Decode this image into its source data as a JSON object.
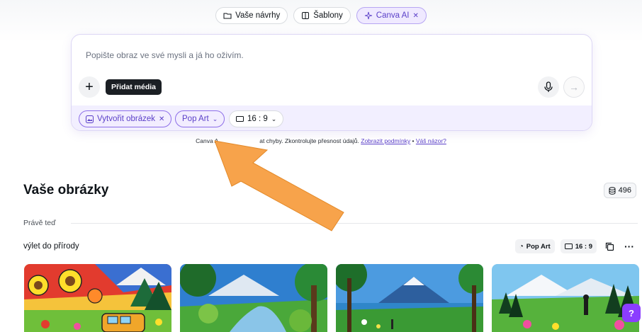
{
  "tabs": [
    {
      "label": "Vaše návrhy",
      "icon": "folder-icon"
    },
    {
      "label": "Šablony",
      "icon": "template-icon"
    },
    {
      "label": "Canva AI",
      "icon": "sparkle-icon",
      "close": "✕"
    }
  ],
  "prompt": {
    "placeholder": "Popište obraz ve své mysli a já ho oživím.",
    "add_tooltip": "Přidat média",
    "chips": {
      "create_image": "Vytvořit obrázek",
      "create_image_close": "✕",
      "style": "Pop Art",
      "ratio": "16 : 9"
    }
  },
  "disclaimer": {
    "text_before": "Canva A",
    "text_middle": "at chyby. Zkontrolujte přesnost údajů. ",
    "terms_link": "Zobrazit podmínky",
    "separator": " • ",
    "feedback_link": "Váš názor?"
  },
  "section": {
    "title": "Vaše obrázky",
    "credits": "496",
    "just_now": "Právě teď",
    "trip_title": "výlet do přírody",
    "trip_style": "Pop Art",
    "trip_ratio": "16 : 9",
    "more": "···"
  },
  "help": "?",
  "colors": {
    "accent": "#8b3dff",
    "chip_purple": "#5a3fc8",
    "arrow_orange": "#f7a34b"
  }
}
